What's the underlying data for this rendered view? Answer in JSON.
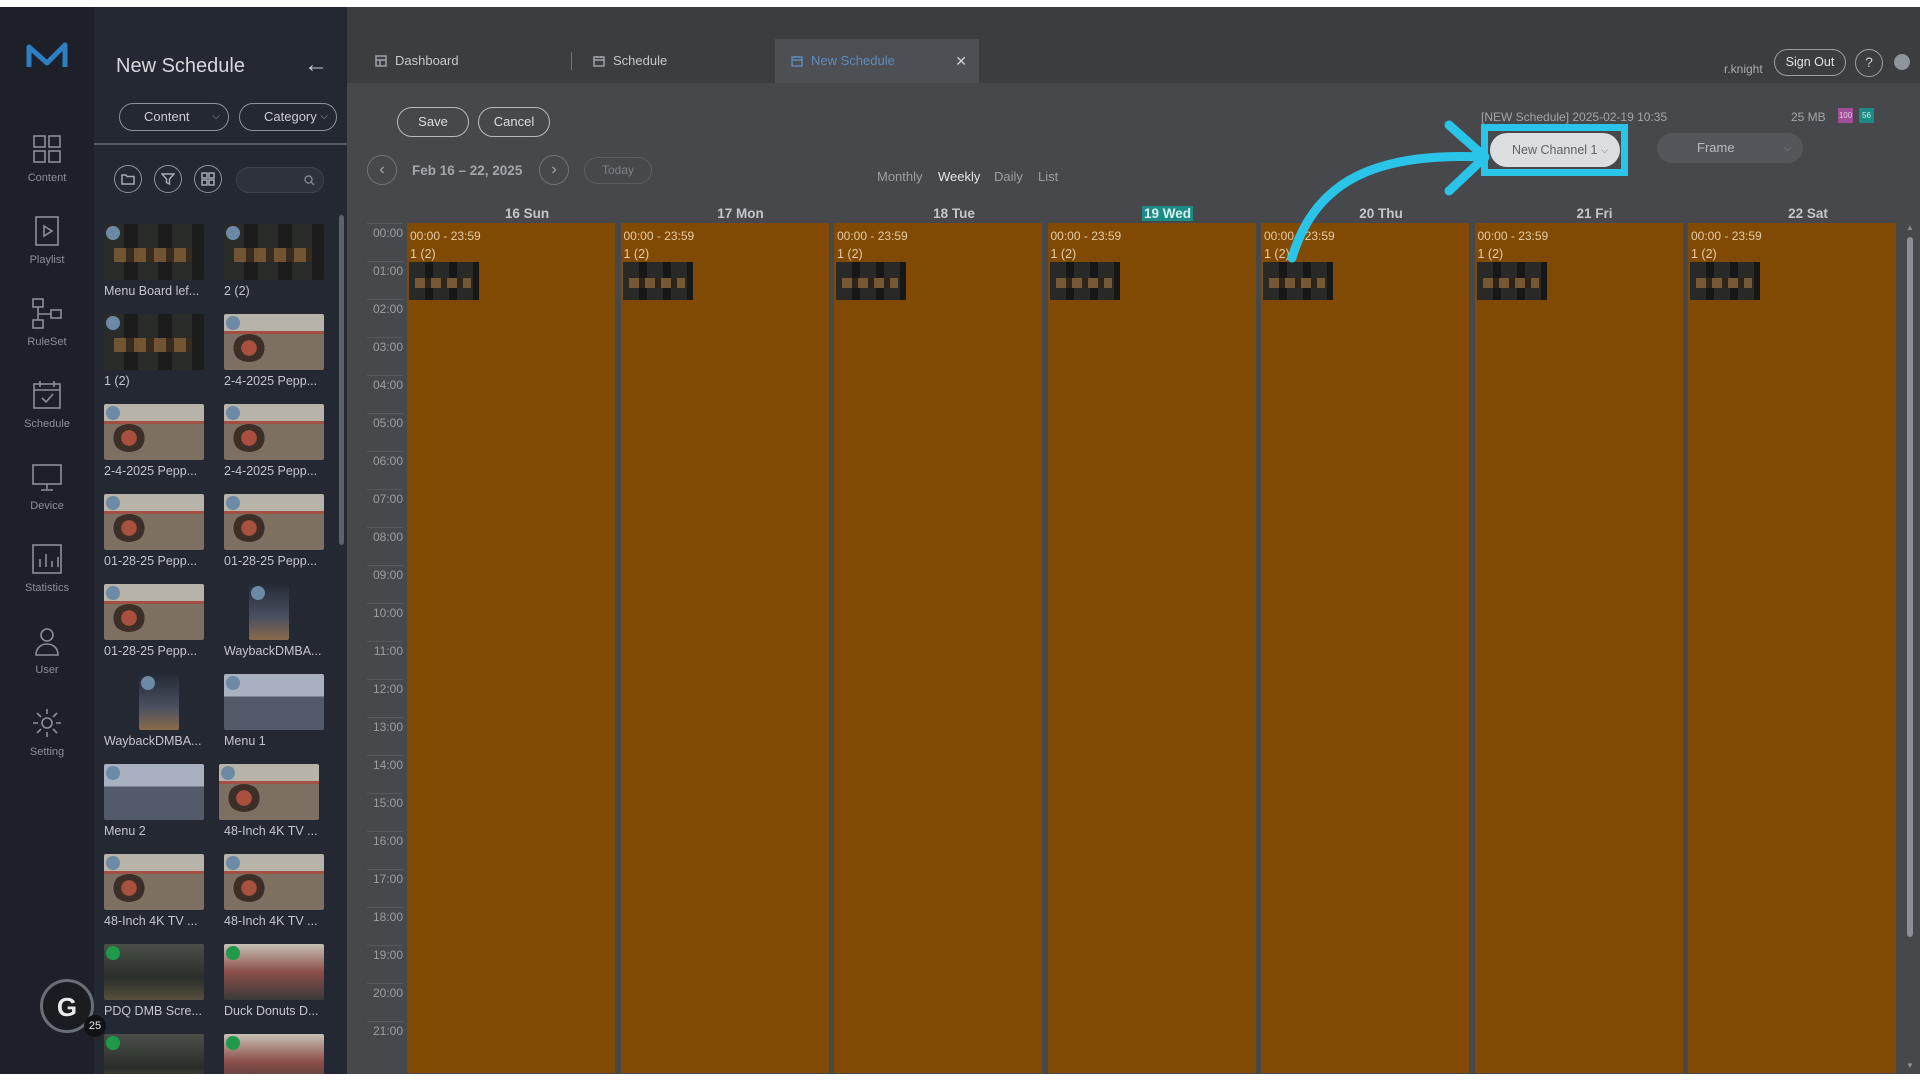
{
  "panel": {
    "title": "New Schedule",
    "content_select": "Content",
    "category_select": "Category",
    "items": [
      {
        "label": "Menu Board lef...",
        "kind": "dark",
        "badge": "image"
      },
      {
        "label": "2 (2)",
        "kind": "dark",
        "badge": "image"
      },
      {
        "label": "1 (2)",
        "kind": "dark",
        "badge": "image"
      },
      {
        "label": "2-4-2025 Pepp...",
        "kind": "food",
        "badge": "image"
      },
      {
        "label": "2-4-2025 Pepp...",
        "kind": "food",
        "badge": "image"
      },
      {
        "label": "2-4-2025 Pepp...",
        "kind": "food",
        "badge": "image"
      },
      {
        "label": "01-28-25 Pepp...",
        "kind": "food",
        "badge": "image"
      },
      {
        "label": "01-28-25 Pepp...",
        "kind": "food",
        "badge": "image"
      },
      {
        "label": "01-28-25 Pepp...",
        "kind": "food",
        "badge": "image"
      },
      {
        "label": "WaybackDMBA...",
        "kind": "tall",
        "badge": "image"
      },
      {
        "label": "WaybackDMBA...",
        "kind": "tall",
        "badge": "image"
      },
      {
        "label": "Menu 1",
        "kind": "menu",
        "badge": "image"
      },
      {
        "label": "Menu 2",
        "kind": "menu",
        "badge": "image"
      },
      {
        "label": "48-Inch 4K TV ...",
        "kind": "food",
        "badge": "image"
      },
      {
        "label": "48-Inch 4K TV ...",
        "kind": "food",
        "badge": "image"
      },
      {
        "label": "48-Inch 4K TV ...",
        "kind": "food",
        "badge": "image"
      },
      {
        "label": "PDQ DMB Scre...",
        "kind": "video",
        "badge": "video"
      },
      {
        "label": "Duck Donuts D...",
        "kind": "donut",
        "badge": "video"
      },
      {
        "label": "",
        "kind": "video",
        "badge": "video"
      },
      {
        "label": "",
        "kind": "donut",
        "badge": "video"
      }
    ]
  },
  "rail": {
    "items": [
      {
        "label": "Content",
        "icon": "grid-icon"
      },
      {
        "label": "Playlist",
        "icon": "playlist-icon"
      },
      {
        "label": "RuleSet",
        "icon": "ruleset-icon"
      },
      {
        "label": "Schedule",
        "icon": "calendar-icon"
      },
      {
        "label": "Device",
        "icon": "monitor-icon"
      },
      {
        "label": "Statistics",
        "icon": "bar-chart-icon"
      },
      {
        "label": "User",
        "icon": "user-icon"
      },
      {
        "label": "Setting",
        "icon": "gear-icon"
      }
    ]
  },
  "gamification": {
    "letter": "G",
    "count": "25"
  },
  "tabs": [
    {
      "label": "Dashboard",
      "icon": "dashboard-icon"
    },
    {
      "label": "Schedule",
      "icon": "calendar-icon"
    },
    {
      "label": "New Schedule",
      "icon": "calendar-icon",
      "active": true
    }
  ],
  "header": {
    "user": "r.knight",
    "sign_out": "Sign Out",
    "help": "?"
  },
  "toolbar": {
    "save": "Save",
    "cancel": "Cancel",
    "schedule_meta": "[NEW Schedule] 2025-02-19 10:35",
    "storage": "25 MB",
    "badge_a": "100",
    "badge_b": "56"
  },
  "calendar": {
    "range": "Feb 16 – 22, 2025",
    "today": "Today",
    "prev": "‹",
    "next": "›",
    "views": [
      "Monthly",
      "Weekly",
      "Daily",
      "List"
    ],
    "active_view": "Weekly",
    "channel": "New Channel 1",
    "frame": "Frame",
    "days": [
      "16 Sun",
      "17 Mon",
      "18 Tue",
      "19 Wed",
      "20 Thu",
      "21 Fri",
      "22 Sat"
    ],
    "today_day": "19 Wed",
    "hours": [
      "00:00",
      "01:00",
      "02:00",
      "03:00",
      "04:00",
      "05:00",
      "06:00",
      "07:00",
      "08:00",
      "09:00",
      "10:00",
      "11:00",
      "12:00",
      "13:00",
      "14:00",
      "15:00",
      "16:00",
      "17:00",
      "18:00",
      "19:00",
      "20:00",
      "21:00"
    ],
    "event_time": "00:00 - 23:59",
    "event_name": "1 (2)",
    "event_color": "#f28c07",
    "highlight_color": "#29c4e8"
  }
}
